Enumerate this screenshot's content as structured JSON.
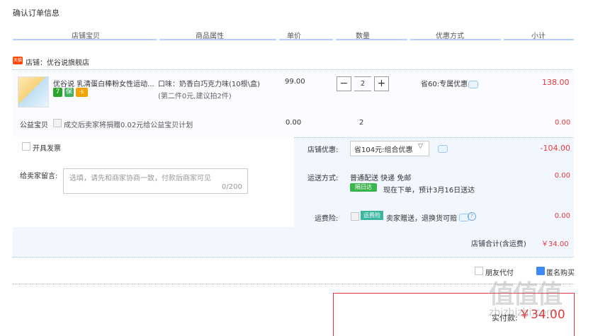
{
  "page_title": "确认订单信息",
  "columns": [
    "店铺宝贝",
    "商品属性",
    "单价",
    "数量",
    "优惠方式",
    "小计"
  ],
  "store": {
    "badge": "天猫",
    "name": "店铺：优谷说旗舰店"
  },
  "product": {
    "title": "优谷说 乳清蛋白棒粉女性运动...",
    "icons": [
      "7",
      "保",
      "卡"
    ],
    "attr_flavor": "口味：奶香白巧克力味(10根\\盒)",
    "attr_note": "(第二件0元,建议拍2件)",
    "price": "99.00",
    "qty": "2",
    "discount": "省60:专属优惠",
    "subtotal": "138.00"
  },
  "charity": {
    "label": "公益宝贝",
    "text": "成交后卖家将捐赠0.02元给公益宝贝计划",
    "price": "0.00",
    "qty": "2",
    "subtotal": "0.00"
  },
  "invoice": {
    "label": "开具发票"
  },
  "message": {
    "label": "给卖家留言:",
    "placeholder": "选填，请先和商家协商一致，付款后商家可见",
    "count": "0/200"
  },
  "store_discount": {
    "label": "店铺优惠:",
    "selected": "省104元:组合优惠",
    "value": "-104.00"
  },
  "shipping": {
    "label": "运送方式:",
    "method": "普通配送 快递 免邮",
    "badge": "隔日达",
    "eta": "现在下单，预计3月16日送达",
    "value": "0.00"
  },
  "insurance": {
    "label": "运费险:",
    "badge": "运费险",
    "text": "卖家赠送，退换货可赔",
    "value": "0.00"
  },
  "store_total": {
    "label": "店铺合计(含运费)",
    "value": "￥34.00"
  },
  "options": {
    "pay_for_me": "朋友代付",
    "anonymous": "匿名购买"
  },
  "payment": {
    "label": "实付款:",
    "amount": "￥34.00"
  },
  "watermark": {
    "text": "值值值",
    "sub": "zhizhizhi.com"
  },
  "colors": {
    "accent": "#e4393c",
    "link_blue": "#3e89fa",
    "header_line": "#b2d1ff"
  }
}
